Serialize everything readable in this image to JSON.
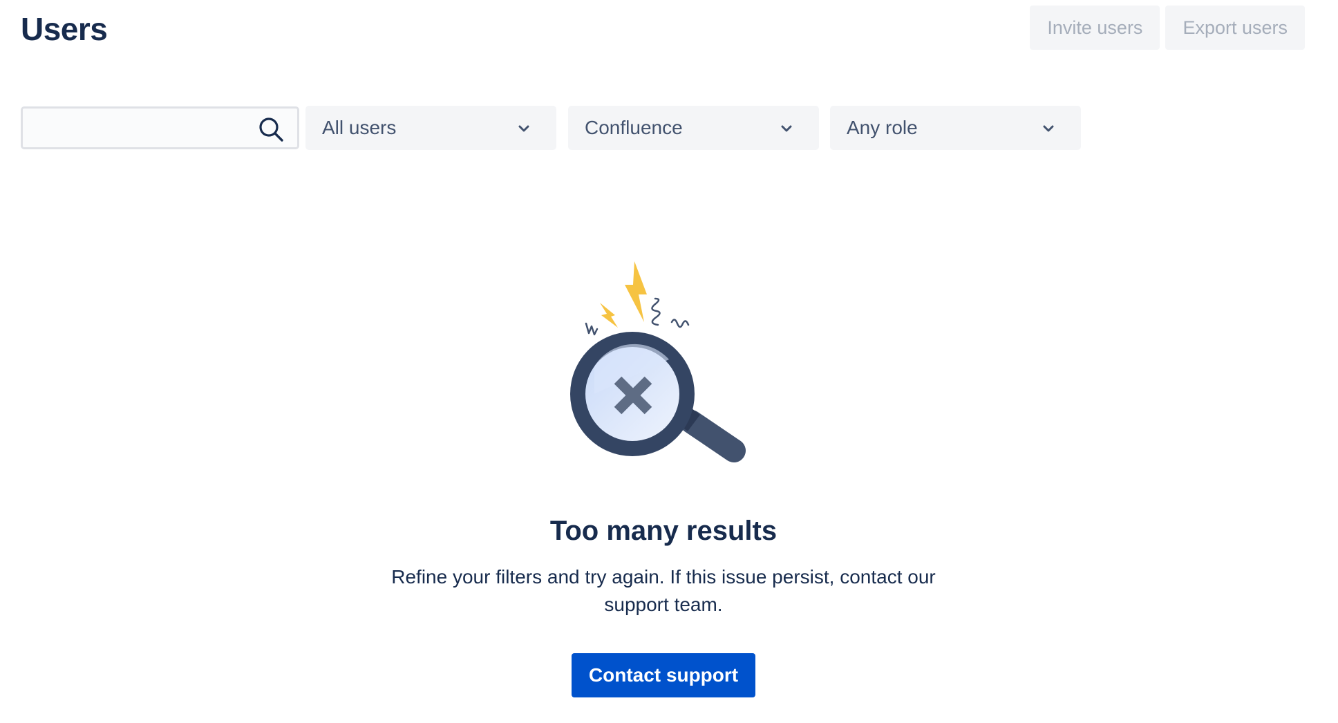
{
  "header": {
    "title": "Users",
    "invite_label": "Invite users",
    "export_label": "Export users"
  },
  "filters": {
    "search": {
      "value": "",
      "placeholder": ""
    },
    "user_type": "All users",
    "product": "Confluence",
    "role": "Any role"
  },
  "empty_state": {
    "title": "Too many results",
    "description_line1": "Refine your filters and try again. If this issue persist, contact our",
    "description_line2": "support team.",
    "button_label": "Contact support"
  },
  "icons": {
    "search": "search-icon",
    "chevron": "chevron-down-icon",
    "illustration": "magnifying-glass-x-illustration"
  },
  "colors": {
    "primary": "#0052cc",
    "title": "#172b4d",
    "disabled_bg": "#f4f5f7",
    "disabled_text": "#a5adba",
    "accent_yellow": "#f6c342"
  }
}
